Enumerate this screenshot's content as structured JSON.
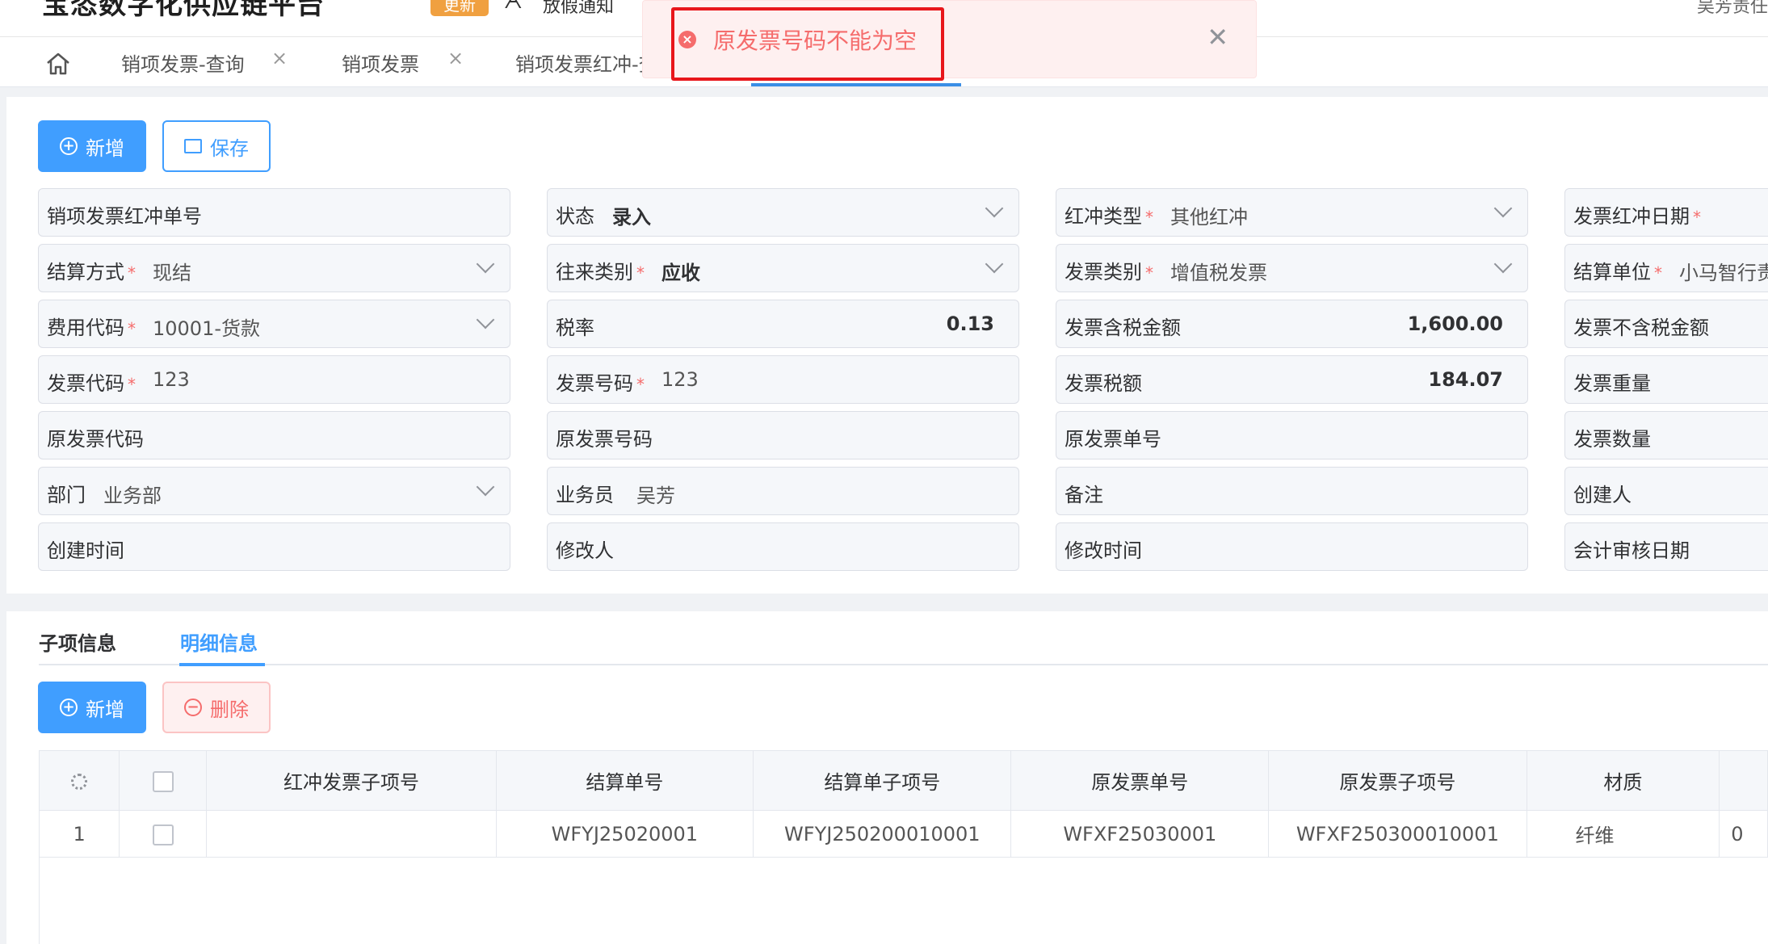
{
  "header": {
    "app_title": "宝恣数字化供应链平台",
    "update_badge": "更新",
    "notice_icon": "ᗅ",
    "notice": "放假通知",
    "user": "吴芳责任"
  },
  "tabs": [
    {
      "label": "销项发票-查询",
      "close": "×"
    },
    {
      "label": "销项发票",
      "close": "×"
    },
    {
      "label": "销项发票红冲-查"
    }
  ],
  "toast": {
    "message": "原发票号码不能为空",
    "icon": "×",
    "close": "✕",
    "type": "error",
    "color": "#f56c6c"
  },
  "toolbar": {
    "add_icon": "+",
    "add": "新增",
    "save": "保存"
  },
  "form": {
    "c1": [
      {
        "label": "销项发票红冲单号"
      },
      {
        "label": "结算方式",
        "required": "*",
        "value": "现结"
      },
      {
        "label": "费用代码",
        "required": "*",
        "value": "10001-货款"
      },
      {
        "label": "发票代码",
        "required": "*",
        "value": "123"
      },
      {
        "label": "原发票代码"
      },
      {
        "label": "部门",
        "value": "业务部"
      },
      {
        "label": "创建时间"
      }
    ],
    "c2": [
      {
        "label": "状态",
        "value": "录入"
      },
      {
        "label": "往来类别",
        "required": "*",
        "value": "应收"
      },
      {
        "label": "税率",
        "value": "0.13"
      },
      {
        "label": "发票号码",
        "required": "*",
        "value": "123"
      },
      {
        "label": "原发票号码"
      },
      {
        "label": "业务员",
        "value": "吴芳"
      },
      {
        "label": "修改人"
      }
    ],
    "c3": [
      {
        "label": "红冲类型",
        "required": "*",
        "value": "其他红冲"
      },
      {
        "label": "发票类别",
        "required": "*",
        "value": "增值税发票"
      },
      {
        "label": "发票含税金额",
        "value": "1,600.00"
      },
      {
        "label": "发票税额",
        "value": "184.07"
      },
      {
        "label": "原发票单号"
      },
      {
        "label": "备注"
      },
      {
        "label": "修改时间"
      }
    ],
    "c4": [
      {
        "label": "发票红冲日期",
        "required": "*"
      },
      {
        "label": "结算单位",
        "required": "*",
        "value": "小马智行责"
      },
      {
        "label": "发票不含税金额"
      },
      {
        "label": "发票重量"
      },
      {
        "label": "发票数量"
      },
      {
        "label": "创建人"
      },
      {
        "label": "会计审核日期"
      }
    ]
  },
  "detail": {
    "tabs": [
      "子项信息",
      "明细信息"
    ],
    "add": "新增",
    "add_icon": "+",
    "delete": "删除",
    "delete_icon": "−",
    "columns": [
      "红冲发票子项号",
      "结算单号",
      "结算单子项号",
      "原发票单号",
      "原发票子项号",
      "材质"
    ],
    "rows": [
      {
        "index": "1",
        "cells": [
          "",
          "WFYJ25020001",
          "WFYJ250200010001",
          "WFXF25030001",
          "WFXF250300010001",
          "纤维"
        ],
        "extra": "0"
      }
    ]
  }
}
